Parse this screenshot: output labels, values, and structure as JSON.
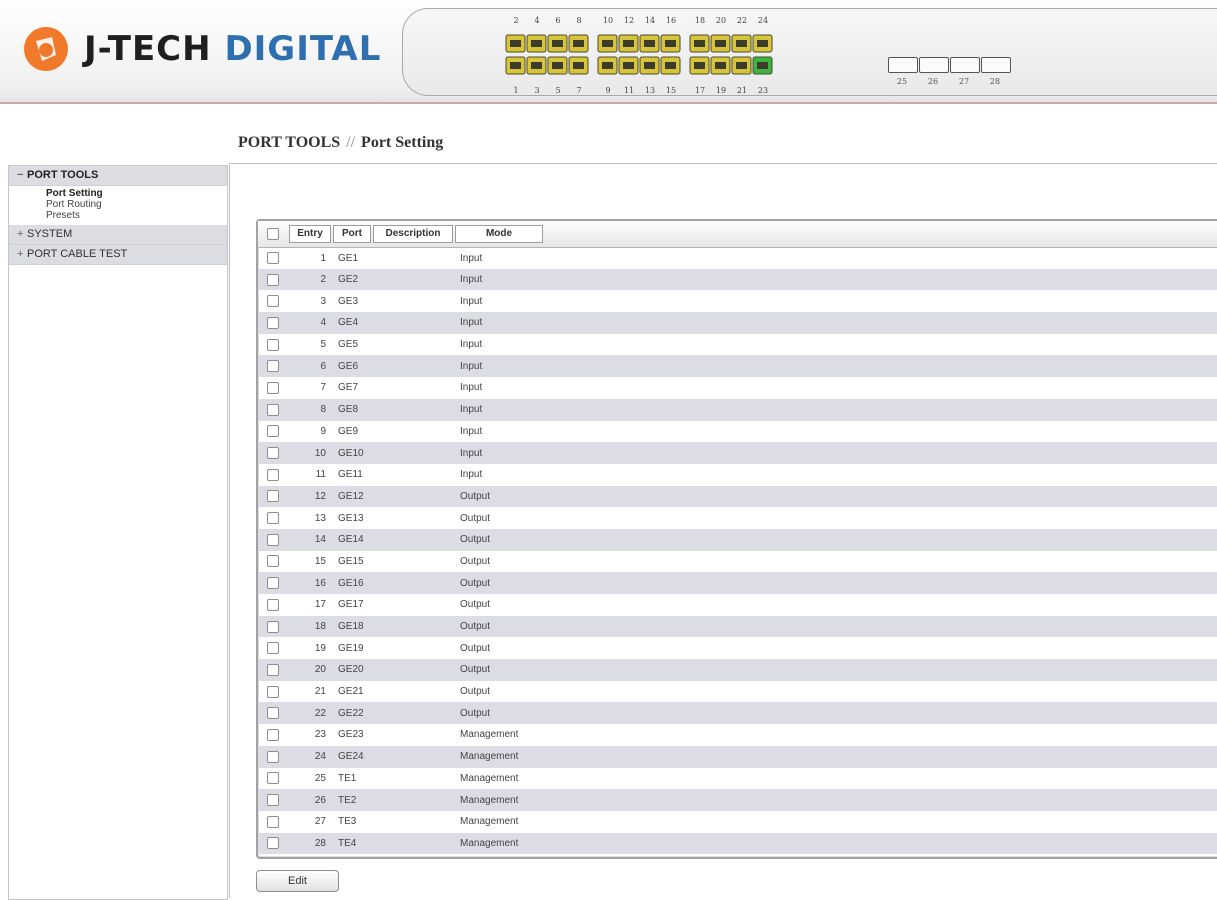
{
  "brand": {
    "logo_text_1": "J-TECH ",
    "logo_text_2": "DIGITAL",
    "orange": "#f07a2a",
    "blue": "#2f6fb0"
  },
  "port_panel": {
    "top_labels": [
      "2",
      "4",
      "6",
      "8",
      "10",
      "12",
      "14",
      "16",
      "18",
      "20",
      "22",
      "24"
    ],
    "bottom_labels": [
      "1",
      "3",
      "5",
      "7",
      "9",
      "11",
      "13",
      "15",
      "17",
      "19",
      "21",
      "23"
    ],
    "sfp_labels": [
      "25",
      "26",
      "27",
      "28"
    ],
    "active_port": "23",
    "port_color": "#d7c43a",
    "active_color": "#3fb33f"
  },
  "breadcrumb": {
    "section": "PORT TOOLS",
    "separator": "//",
    "page": "Port Setting"
  },
  "sidebar": {
    "groups": [
      {
        "label": "PORT TOOLS",
        "sign": "−",
        "expanded": true,
        "items": [
          "Port Setting",
          "Port Routing",
          "Presets"
        ],
        "selected": "Port Setting"
      },
      {
        "label": "SYSTEM",
        "sign": "+",
        "expanded": false,
        "items": []
      },
      {
        "label": "PORT CABLE TEST",
        "sign": "+",
        "expanded": false,
        "items": []
      }
    ]
  },
  "table": {
    "headers": {
      "entry": "Entry",
      "port": "Port",
      "description": "Description",
      "mode": "Mode"
    },
    "rows": [
      {
        "entry": "1",
        "port": "GE1",
        "description": "",
        "mode": "Input"
      },
      {
        "entry": "2",
        "port": "GE2",
        "description": "",
        "mode": "Input"
      },
      {
        "entry": "3",
        "port": "GE3",
        "description": "",
        "mode": "Input"
      },
      {
        "entry": "4",
        "port": "GE4",
        "description": "",
        "mode": "Input"
      },
      {
        "entry": "5",
        "port": "GE5",
        "description": "",
        "mode": "Input"
      },
      {
        "entry": "6",
        "port": "GE6",
        "description": "",
        "mode": "Input"
      },
      {
        "entry": "7",
        "port": "GE7",
        "description": "",
        "mode": "Input"
      },
      {
        "entry": "8",
        "port": "GE8",
        "description": "",
        "mode": "Input"
      },
      {
        "entry": "9",
        "port": "GE9",
        "description": "",
        "mode": "Input"
      },
      {
        "entry": "10",
        "port": "GE10",
        "description": "",
        "mode": "Input"
      },
      {
        "entry": "11",
        "port": "GE11",
        "description": "",
        "mode": "Input"
      },
      {
        "entry": "12",
        "port": "GE12",
        "description": "",
        "mode": "Output"
      },
      {
        "entry": "13",
        "port": "GE13",
        "description": "",
        "mode": "Output"
      },
      {
        "entry": "14",
        "port": "GE14",
        "description": "",
        "mode": "Output"
      },
      {
        "entry": "15",
        "port": "GE15",
        "description": "",
        "mode": "Output"
      },
      {
        "entry": "16",
        "port": "GE16",
        "description": "",
        "mode": "Output"
      },
      {
        "entry": "17",
        "port": "GE17",
        "description": "",
        "mode": "Output"
      },
      {
        "entry": "18",
        "port": "GE18",
        "description": "",
        "mode": "Output"
      },
      {
        "entry": "19",
        "port": "GE19",
        "description": "",
        "mode": "Output"
      },
      {
        "entry": "20",
        "port": "GE20",
        "description": "",
        "mode": "Output"
      },
      {
        "entry": "21",
        "port": "GE21",
        "description": "",
        "mode": "Output"
      },
      {
        "entry": "22",
        "port": "GE22",
        "description": "",
        "mode": "Output"
      },
      {
        "entry": "23",
        "port": "GE23",
        "description": "",
        "mode": "Management"
      },
      {
        "entry": "24",
        "port": "GE24",
        "description": "",
        "mode": "Management"
      },
      {
        "entry": "25",
        "port": "TE1",
        "description": "",
        "mode": "Management"
      },
      {
        "entry": "26",
        "port": "TE2",
        "description": "",
        "mode": "Management"
      },
      {
        "entry": "27",
        "port": "TE3",
        "description": "",
        "mode": "Management"
      },
      {
        "entry": "28",
        "port": "TE4",
        "description": "",
        "mode": "Management"
      }
    ]
  },
  "buttons": {
    "edit": "Edit"
  }
}
